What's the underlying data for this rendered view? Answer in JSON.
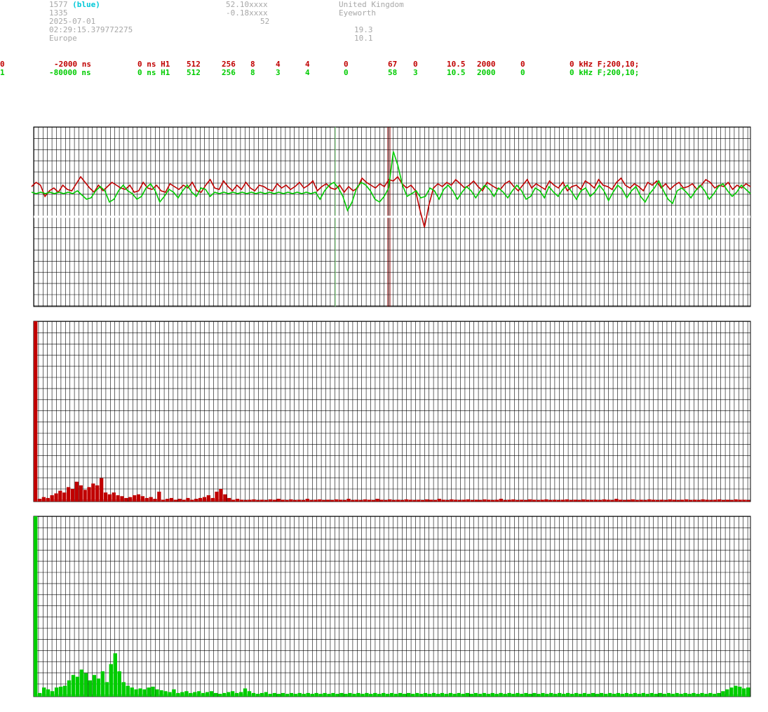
{
  "header": {
    "station_id": "1577",
    "station_color": "(blue)",
    "station_num": "1335",
    "date": "2025-07-01",
    "time": "02:29:15.379772275",
    "region": "Europe",
    "lat": "52.10xxxx",
    "lon": "-0.18xxxx",
    "alt": "52",
    "country": "United Kingdom",
    "place": "Eyeworth",
    "val1": "19.3",
    "val2": "10.1"
  },
  "channels": [
    {
      "id": "0",
      "color": "#c00000",
      "cols": [
        "0",
        "-2000 ns",
        "0 ns H1",
        "512",
        "256",
        "8",
        "4",
        "4",
        "0",
        "67",
        "0",
        "10.5",
        "2000",
        "0",
        "0 kHz F;200,10;"
      ]
    },
    {
      "id": "1",
      "color": "#00cc00",
      "cols": [
        "1",
        "-80000 ns",
        "0 ns H1",
        "512",
        "256",
        "8",
        "3",
        "4",
        "0",
        "58",
        "3",
        "10.5",
        "2000",
        "0",
        "0 kHz F;200,10;"
      ]
    }
  ],
  "chart_data": [
    {
      "type": "line",
      "name_panel": "waveform",
      "series": [
        {
          "color": "#c00000",
          "values": [
            0.25,
            0.4,
            0.3,
            -0.1,
            0.1,
            0.2,
            0.05,
            0.3,
            0.15,
            0.1,
            0.35,
            0.6,
            0.4,
            0.2,
            0.05,
            0.3,
            0.1,
            0.25,
            0.4,
            0.3,
            0.2,
            0.15,
            0.3,
            0.05,
            0.1,
            0.4,
            0.2,
            0.15,
            0.3,
            0.1,
            0.05,
            0.35,
            0.25,
            0.15,
            0.3,
            0.2,
            0.4,
            0.1,
            0.05,
            0.3,
            0.5,
            0.2,
            0.15,
            0.45,
            0.25,
            0.1,
            0.3,
            0.15,
            0.4,
            0.2,
            0.1,
            0.3,
            0.25,
            0.15,
            0.1,
            0.35,
            0.2,
            0.3,
            0.15,
            0.25,
            0.4,
            0.2,
            0.3,
            0.45,
            0.1,
            0.25,
            0.35,
            0.2,
            0.15,
            0.3,
            0.05,
            0.25,
            0.1,
            0.2,
            0.55,
            0.4,
            0.3,
            0.2,
            0.35,
            0.25,
            0.5,
            0.45,
            0.6,
            0.35,
            0.2,
            0.3,
            0.1,
            -0.6,
            -1.2,
            -0.4,
            0.2,
            0.35,
            0.25,
            0.4,
            0.3,
            0.5,
            0.35,
            0.2,
            0.3,
            0.45,
            0.25,
            0.1,
            0.4,
            0.3,
            0.2,
            0.15,
            0.35,
            0.45,
            0.25,
            0.1,
            0.3,
            0.5,
            0.2,
            0.35,
            0.25,
            0.15,
            0.45,
            0.3,
            0.2,
            0.4,
            0.1,
            0.25,
            0.3,
            0.15,
            0.45,
            0.35,
            0.2,
            0.5,
            0.3,
            0.25,
            0.15,
            0.4,
            0.55,
            0.3,
            0.2,
            0.35,
            0.25,
            0.1,
            0.4,
            0.3,
            0.45,
            0.2,
            0.35,
            0.15,
            0.3,
            0.4,
            0.2,
            0.25,
            0.35,
            0.15,
            0.3,
            0.5,
            0.4,
            0.2,
            0.3,
            0.25,
            0.4,
            0.15,
            0.3,
            0.2,
            0.35,
            0.25
          ]
        },
        {
          "color": "#00cc00",
          "values": [
            0.05,
            0.0,
            0.05,
            0.0,
            0.05,
            0.0,
            0.05,
            0.0,
            0.05,
            0.0,
            0.1,
            -0.05,
            -0.2,
            -0.15,
            0.1,
            0.25,
            0.1,
            -0.3,
            -0.2,
            0.1,
            0.3,
            0.1,
            0.0,
            -0.2,
            -0.1,
            0.2,
            0.35,
            0.1,
            -0.3,
            -0.1,
            0.15,
            0.05,
            -0.15,
            0.1,
            0.3,
            0.05,
            -0.1,
            0.2,
            0.15,
            -0.1,
            0.05,
            0.0,
            0.05,
            0.0,
            0.05,
            0.0,
            0.05,
            0.0,
            0.05,
            0.0,
            0.05,
            0.0,
            0.05,
            0.0,
            0.05,
            0.0,
            0.05,
            0.0,
            0.05,
            0.0,
            0.05,
            0.0,
            0.05,
            -0.2,
            0.1,
            0.3,
            0.4,
            0.2,
            -0.1,
            -0.6,
            -0.3,
            0.2,
            0.4,
            0.3,
            0.1,
            -0.2,
            -0.3,
            -0.1,
            0.2,
            1.5,
            1.0,
            0.3,
            -0.1,
            0.0,
            0.1,
            -0.15,
            -0.1,
            0.2,
            0.1,
            -0.2,
            0.15,
            0.3,
            0.1,
            -0.2,
            0.05,
            0.25,
            0.1,
            -0.15,
            0.1,
            0.3,
            0.15,
            -0.1,
            0.2,
            0.05,
            -0.15,
            0.1,
            0.3,
            0.1,
            -0.2,
            -0.1,
            0.2,
            0.1,
            -0.15,
            0.25,
            0.05,
            -0.1,
            0.15,
            0.3,
            0.05,
            -0.2,
            0.1,
            0.2,
            -0.1,
            0.05,
            0.3,
            0.1,
            -0.25,
            0.05,
            0.3,
            0.15,
            -0.15,
            0.1,
            0.25,
            -0.1,
            -0.3,
            0.0,
            0.2,
            0.45,
            0.1,
            -0.2,
            -0.35,
            0.1,
            0.2,
            0.05,
            -0.15,
            0.1,
            0.3,
            0.1,
            -0.2,
            0.0,
            0.25,
            0.35,
            0.1,
            -0.1,
            0.05,
            0.3,
            0.15,
            0.0
          ]
        }
      ]
    },
    {
      "type": "bar",
      "name_panel": "spectrum-0",
      "color": "#c00000",
      "values": [
        1.0,
        0.015,
        0.025,
        0.02,
        0.035,
        0.045,
        0.06,
        0.05,
        0.08,
        0.07,
        0.11,
        0.09,
        0.065,
        0.08,
        0.1,
        0.09,
        0.13,
        0.05,
        0.04,
        0.05,
        0.035,
        0.03,
        0.02,
        0.025,
        0.035,
        0.04,
        0.03,
        0.02,
        0.025,
        0.015,
        0.055,
        0.01,
        0.015,
        0.02,
        0.01,
        0.015,
        0.01,
        0.02,
        0.01,
        0.015,
        0.02,
        0.025,
        0.035,
        0.02,
        0.055,
        0.07,
        0.04,
        0.02,
        0.01,
        0.015,
        0.01,
        0.008,
        0.01,
        0.012,
        0.008,
        0.01,
        0.008,
        0.012,
        0.01,
        0.015,
        0.01,
        0.008,
        0.012,
        0.008,
        0.01,
        0.008,
        0.015,
        0.008,
        0.01,
        0.012,
        0.008,
        0.01,
        0.008,
        0.012,
        0.01,
        0.008,
        0.015,
        0.008,
        0.01,
        0.008,
        0.012,
        0.01,
        0.008,
        0.015,
        0.01,
        0.008,
        0.012,
        0.008,
        0.01,
        0.008,
        0.012,
        0.01,
        0.008,
        0.01,
        0.008,
        0.012,
        0.01,
        0.008,
        0.015,
        0.01,
        0.008,
        0.012,
        0.01,
        0.008,
        0.01,
        0.012,
        0.008,
        0.01,
        0.008,
        0.012,
        0.01,
        0.008,
        0.01,
        0.015,
        0.008,
        0.01,
        0.012,
        0.008,
        0.01,
        0.008,
        0.012,
        0.01,
        0.008,
        0.01,
        0.012,
        0.008,
        0.01,
        0.008,
        0.01,
        0.012,
        0.008,
        0.01,
        0.008,
        0.012,
        0.01,
        0.008,
        0.01,
        0.008,
        0.012,
        0.01,
        0.008,
        0.015,
        0.01,
        0.008,
        0.01,
        0.012,
        0.008,
        0.01,
        0.008,
        0.012,
        0.01,
        0.008,
        0.01,
        0.008,
        0.012,
        0.01,
        0.008,
        0.01,
        0.012,
        0.008,
        0.01,
        0.008,
        0.012,
        0.01,
        0.008,
        0.01,
        0.012,
        0.008,
        0.01,
        0.008,
        0.012,
        0.01,
        0.01,
        0.008
      ]
    },
    {
      "type": "bar",
      "name_panel": "spectrum-1",
      "color": "#00cc00",
      "values": [
        1.0,
        0.02,
        0.05,
        0.04,
        0.03,
        0.05,
        0.055,
        0.06,
        0.09,
        0.12,
        0.11,
        0.15,
        0.13,
        0.09,
        0.12,
        0.1,
        0.14,
        0.08,
        0.18,
        0.24,
        0.14,
        0.08,
        0.06,
        0.05,
        0.04,
        0.045,
        0.04,
        0.05,
        0.055,
        0.04,
        0.035,
        0.03,
        0.025,
        0.04,
        0.02,
        0.025,
        0.03,
        0.02,
        0.025,
        0.03,
        0.02,
        0.025,
        0.03,
        0.02,
        0.015,
        0.02,
        0.025,
        0.03,
        0.02,
        0.025,
        0.045,
        0.03,
        0.02,
        0.015,
        0.02,
        0.025,
        0.015,
        0.02,
        0.015,
        0.02,
        0.015,
        0.02,
        0.015,
        0.02,
        0.015,
        0.02,
        0.015,
        0.02,
        0.015,
        0.02,
        0.015,
        0.02,
        0.015,
        0.02,
        0.015,
        0.02,
        0.015,
        0.02,
        0.015,
        0.02,
        0.015,
        0.02,
        0.015,
        0.02,
        0.015,
        0.02,
        0.015,
        0.02,
        0.015,
        0.02,
        0.015,
        0.02,
        0.015,
        0.02,
        0.015,
        0.02,
        0.015,
        0.02,
        0.015,
        0.02,
        0.015,
        0.02,
        0.015,
        0.02,
        0.015,
        0.02,
        0.015,
        0.02,
        0.015,
        0.02,
        0.015,
        0.02,
        0.015,
        0.02,
        0.015,
        0.02,
        0.015,
        0.02,
        0.015,
        0.02,
        0.015,
        0.02,
        0.015,
        0.02,
        0.015,
        0.02,
        0.015,
        0.02,
        0.015,
        0.02,
        0.015,
        0.02,
        0.015,
        0.02,
        0.015,
        0.02,
        0.015,
        0.02,
        0.015,
        0.02,
        0.015,
        0.02,
        0.015,
        0.02,
        0.015,
        0.02,
        0.015,
        0.02,
        0.015,
        0.02,
        0.015,
        0.02,
        0.015,
        0.02,
        0.015,
        0.02,
        0.015,
        0.02,
        0.015,
        0.02,
        0.015,
        0.02,
        0.015,
        0.02,
        0.03,
        0.04,
        0.05,
        0.06,
        0.055,
        0.045,
        0.05
      ]
    }
  ]
}
